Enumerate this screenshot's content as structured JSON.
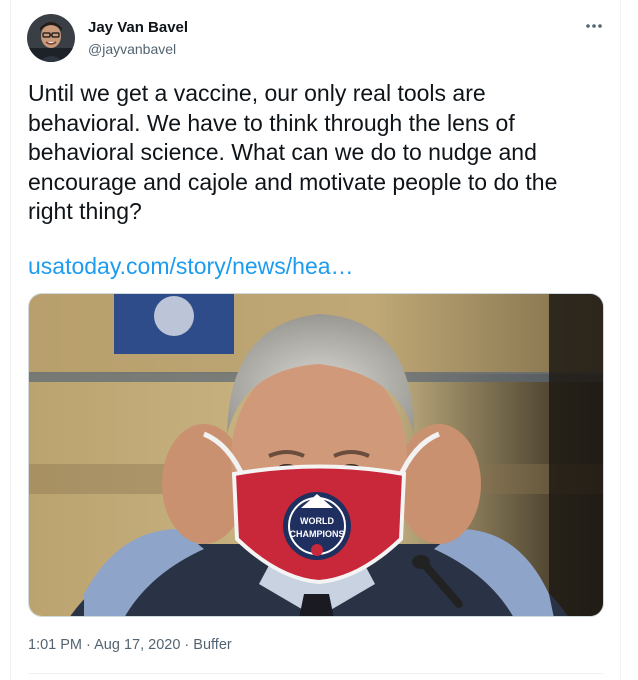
{
  "author": {
    "display_name": "Jay Van Bavel",
    "handle": "@jayvanbavel"
  },
  "tweet": {
    "text": "Until we get a vaccine, our only real tools are\nbehavioral. We have to think through the lens of\nbehavioral science. What can we do to nudge and\nencourage and cajole and motivate people to do the\nright thing?",
    "link_text": "usatoday.com/story/news/hea…",
    "mask_text": "WORLD CHAMPIONS"
  },
  "meta": {
    "time": "1:01 PM",
    "separator_1": "·",
    "date": "Aug 17, 2020",
    "separator_2": "·",
    "source": "Buffer"
  },
  "icons": {
    "more": "more-dots-icon"
  },
  "colors": {
    "link": "#1d9bf0",
    "secondary_text": "#536471",
    "primary_text": "#0f1419",
    "mask_red": "#c8283a"
  }
}
